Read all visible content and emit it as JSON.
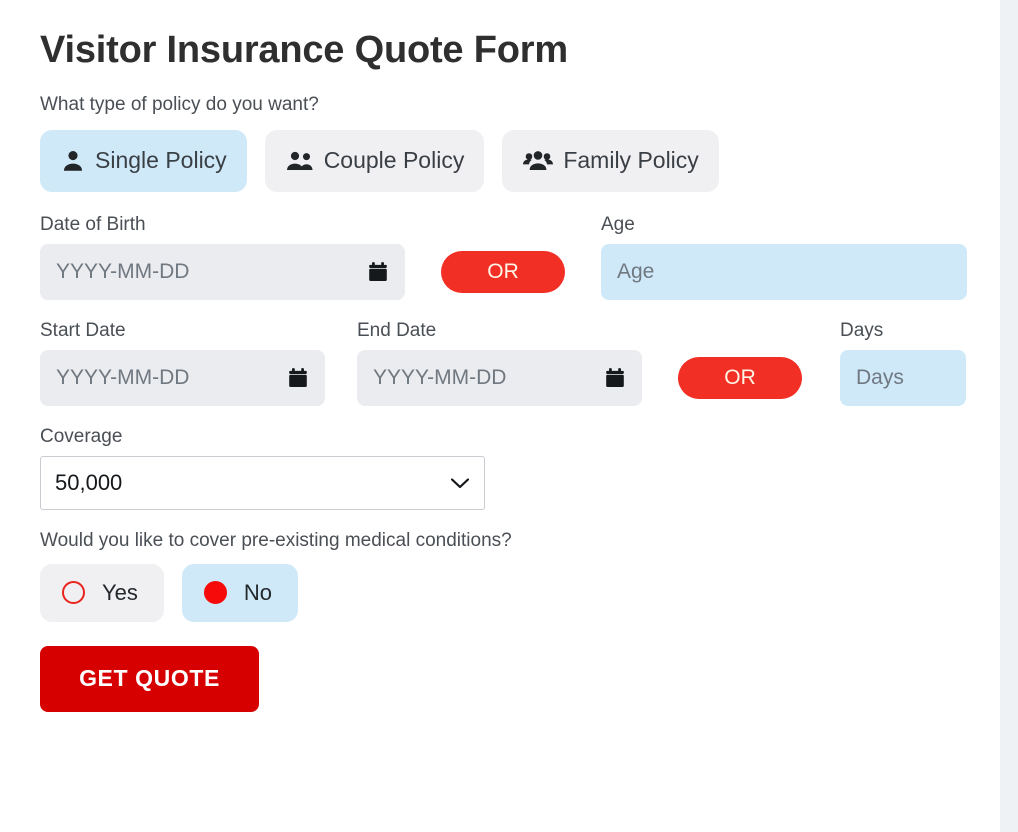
{
  "page": {
    "title": "Visitor Insurance Quote Form",
    "background_color": "#eef2f5",
    "card_color": "#ffffff"
  },
  "policy_type": {
    "question": "What type of policy do you want?",
    "selected": "Single Policy",
    "options": [
      {
        "label": "Single Policy",
        "icon": "user-icon",
        "selected": true
      },
      {
        "label": "Couple Policy",
        "icon": "user-couple-icon",
        "selected": false
      },
      {
        "label": "Family Policy",
        "icon": "user-group-icon",
        "selected": false
      }
    ]
  },
  "date_of_birth": {
    "label": "Date of Birth",
    "value": "",
    "placeholder": "YYYY-MM-DD",
    "icon": "calendar-icon"
  },
  "or_separator_1": {
    "label": "OR",
    "color": "#f22f25",
    "text_color": "#fdf6e7"
  },
  "age": {
    "label": "Age",
    "value": "",
    "placeholder": "Age",
    "background_color": "#cfe9f8"
  },
  "start_date": {
    "label": "Start Date",
    "value": "",
    "placeholder": "YYYY-MM-DD",
    "icon": "calendar-icon"
  },
  "end_date": {
    "label": "End Date",
    "value": "",
    "placeholder": "YYYY-MM-DD",
    "icon": "calendar-icon"
  },
  "or_separator_2": {
    "label": "OR",
    "color": "#f22f25",
    "text_color": "#fdf6e7"
  },
  "days": {
    "label": "Days",
    "value": "",
    "placeholder": "Days",
    "background_color": "#cfe9f8"
  },
  "coverage": {
    "label": "Coverage",
    "selected": "50,000",
    "chevron_icon": "chevron-down-icon"
  },
  "pre_existing": {
    "question": "Would you like to cover pre-existing medical conditions?",
    "selected": "No",
    "options": [
      {
        "label": "Yes",
        "selected": false
      },
      {
        "label": "No",
        "selected": true
      }
    ]
  },
  "submit": {
    "label": "GET QUOTE",
    "color": "#d60000",
    "text_color": "#ffffff"
  }
}
